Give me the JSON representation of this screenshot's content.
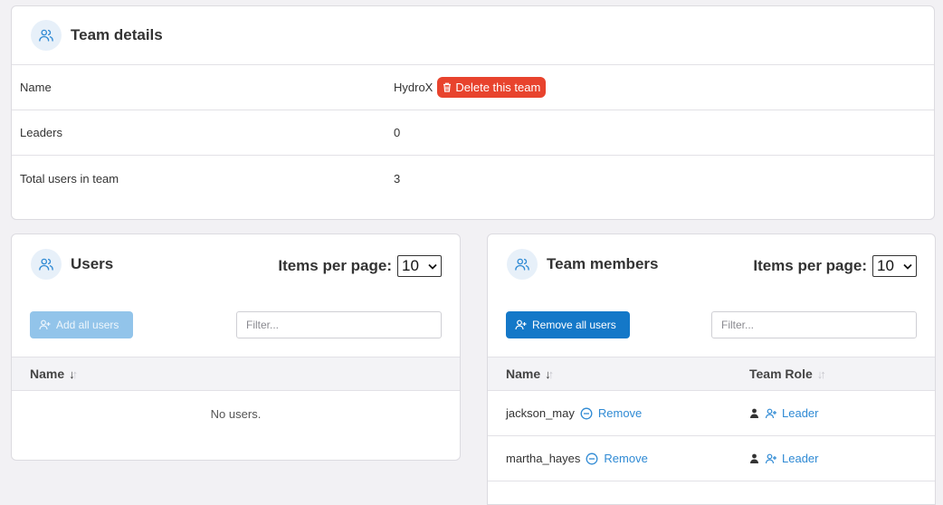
{
  "team_details": {
    "title": "Team details",
    "rows": [
      {
        "label": "Name",
        "value": "HydroX"
      },
      {
        "label": "Leaders",
        "value": "0"
      },
      {
        "label": "Total users in team",
        "value": "3"
      }
    ],
    "delete_label": "Delete this team"
  },
  "users": {
    "title": "Users",
    "items_per_page_label": "Items per page:",
    "items_per_page_value": "10",
    "add_all_label": "Add all users",
    "filter_placeholder": "Filter...",
    "col_name": "Name",
    "empty_text": "No users."
  },
  "members": {
    "title": "Team members",
    "items_per_page_label": "Items per page:",
    "items_per_page_value": "10",
    "remove_all_label": "Remove all users",
    "filter_placeholder": "Filter...",
    "col_name": "Name",
    "col_role": "Team Role",
    "rows": [
      {
        "name": "jackson_may",
        "remove_label": "Remove",
        "role_label": "Leader"
      },
      {
        "name": "martha_hayes",
        "remove_label": "Remove",
        "role_label": "Leader"
      }
    ]
  },
  "colors": {
    "accent": "#1478c8",
    "danger": "#e8432d",
    "link": "#2f8ad4"
  },
  "icons": {
    "team": "users-icon",
    "delete": "trash-icon",
    "add_user": "user-plus-icon",
    "remove": "minus-circle-icon",
    "person": "person-icon"
  }
}
